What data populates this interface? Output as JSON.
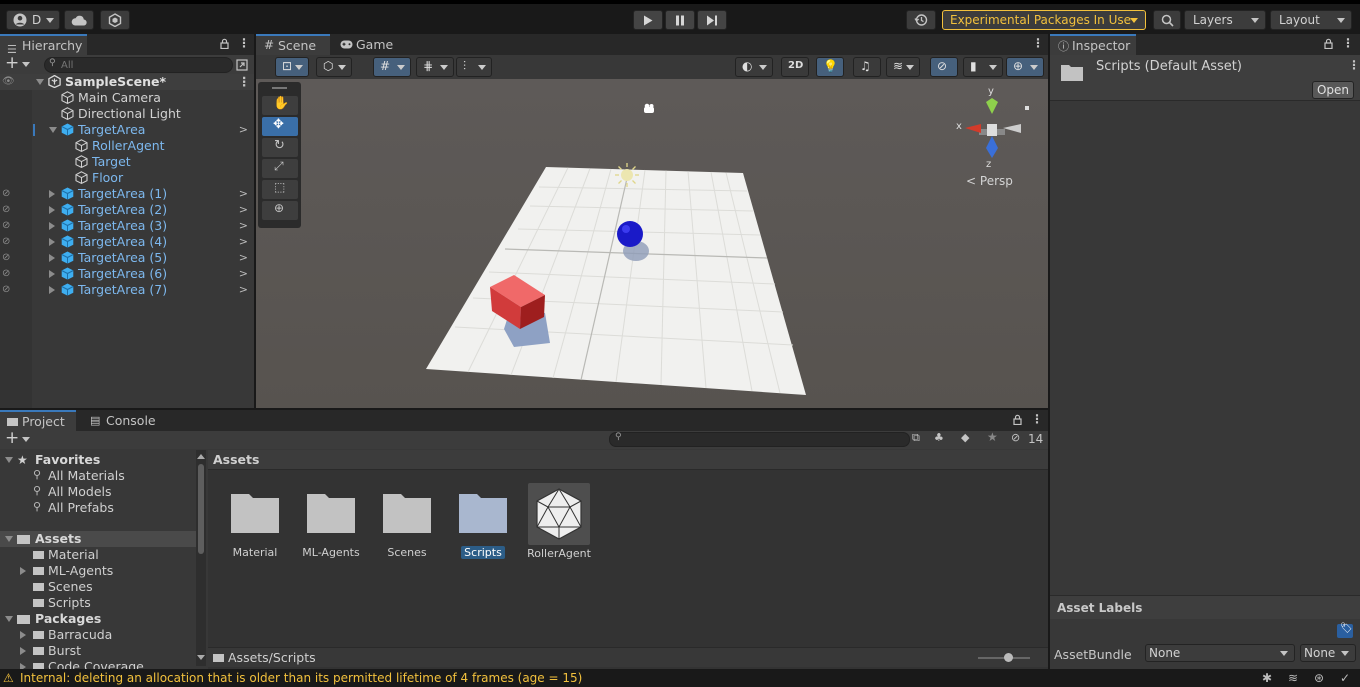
{
  "toolbar": {
    "account_label": "D",
    "experimental_label": "Experimental Packages In Use",
    "layers_label": "Layers",
    "layout_label": "Layout"
  },
  "hierarchy": {
    "tab_label": "Hierarchy",
    "search_placeholder": "All",
    "scene_name": "SampleScene*",
    "items": [
      {
        "label": "Main Camera"
      },
      {
        "label": "Directional Light"
      },
      {
        "label": "TargetArea"
      },
      {
        "label": "RollerAgent"
      },
      {
        "label": "Target"
      },
      {
        "label": "Floor"
      },
      {
        "label": "TargetArea (1)"
      },
      {
        "label": "TargetArea (2)"
      },
      {
        "label": "TargetArea (3)"
      },
      {
        "label": "TargetArea (4)"
      },
      {
        "label": "TargetArea (5)"
      },
      {
        "label": "TargetArea (6)"
      },
      {
        "label": "TargetArea (7)"
      }
    ]
  },
  "scene": {
    "tabs": [
      "Scene",
      "Game"
    ],
    "toggle_2d": "2D",
    "persp_label": "Persp",
    "gizmo_axes": {
      "y": "y",
      "x": "x",
      "z": "z"
    }
  },
  "inspector": {
    "tab_label": "Inspector",
    "asset_title": "Scripts (Default Asset)",
    "open_button": "Open",
    "asset_labels_title": "Asset Labels",
    "assetbundle_label": "AssetBundle",
    "assetbundle_value": "None",
    "variant_value": "None"
  },
  "project": {
    "tabs": [
      "Project",
      "Console"
    ],
    "hidden_count": "14",
    "favorites_label": "Favorites",
    "favorites": [
      "All Materials",
      "All Models",
      "All Prefabs"
    ],
    "assets_label": "Assets",
    "assets_children": [
      "Material",
      "ML-Agents",
      "Scenes",
      "Scripts"
    ],
    "packages_label": "Packages",
    "packages_children": [
      "Barracuda",
      "Burst",
      "Code Coverage"
    ],
    "breadcrumb": "Assets",
    "grid_items": [
      "Material",
      "ML-Agents",
      "Scenes",
      "Scripts",
      "RollerAgent"
    ],
    "path": "Assets/Scripts"
  },
  "status": {
    "message": "Internal: deleting an allocation that is older than its permitted lifetime of 4 frames (age = 15)"
  }
}
